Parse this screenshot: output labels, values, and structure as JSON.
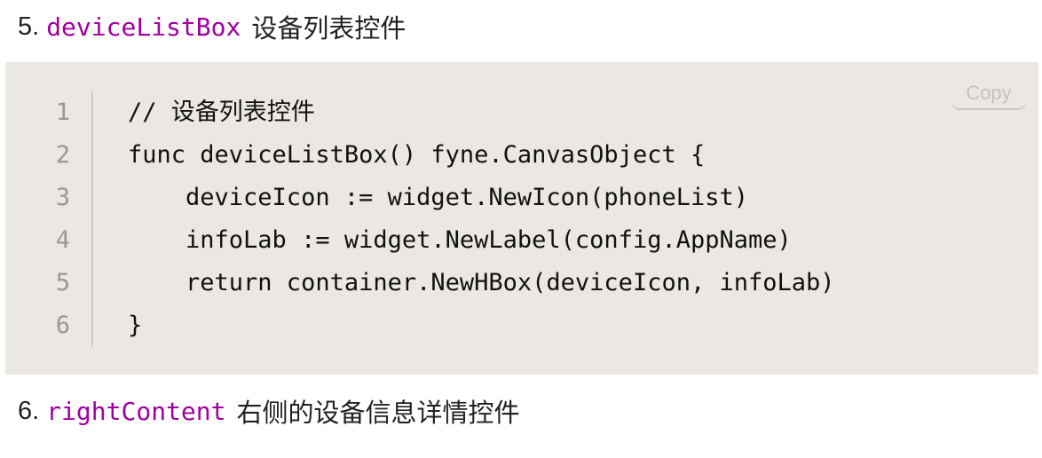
{
  "section5": {
    "number": "5.",
    "identifier": "deviceListBox",
    "description": "设备列表控件"
  },
  "code_block": {
    "copy_label": "Copy",
    "line_numbers": [
      "1",
      "2",
      "3",
      "4",
      "5",
      "6"
    ],
    "lines": [
      "// 设备列表控件",
      "func deviceListBox() fyne.CanvasObject {",
      "    deviceIcon := widget.NewIcon(phoneList)",
      "    infoLab := widget.NewLabel(config.AppName)",
      "    return container.NewHBox(deviceIcon, infoLab)",
      "}"
    ]
  },
  "section6": {
    "number": "6.",
    "identifier": "rightContent",
    "description": "右侧的设备信息详情控件"
  },
  "colors": {
    "identifier": "#a000a0",
    "code_background": "#ebe7e2",
    "line_number": "#9a9692",
    "copy_label": "#c6c2bd"
  }
}
